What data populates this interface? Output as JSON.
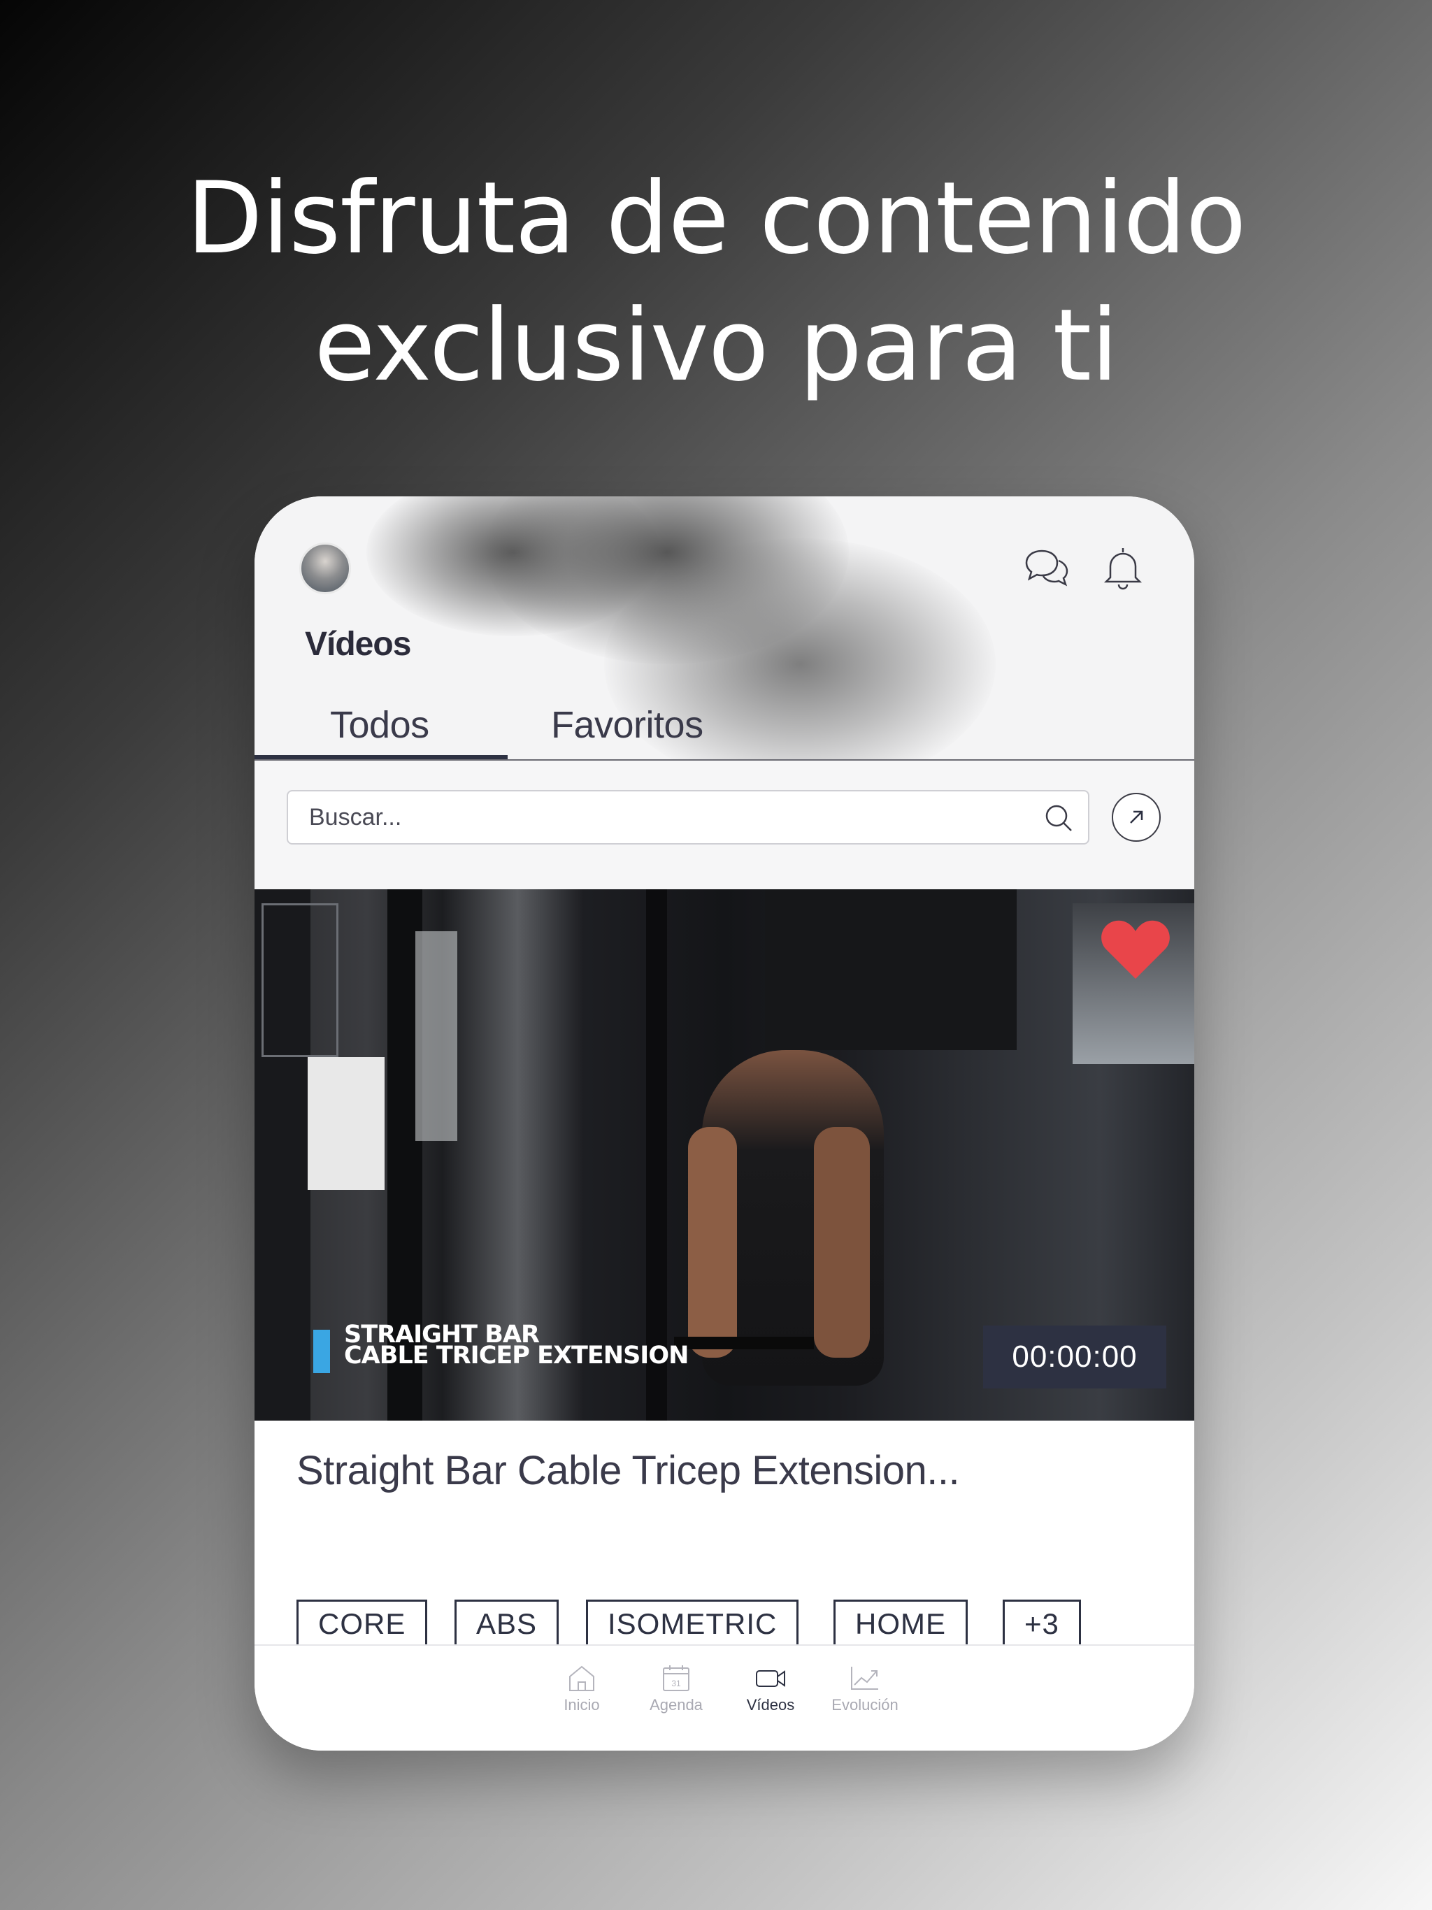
{
  "headline": {
    "line1": "Disfruta de contenido",
    "line2": "exclusivo para ti"
  },
  "app": {
    "section_title": "Vídeos",
    "tabs": [
      {
        "label": "Todos",
        "active": true
      },
      {
        "label": "Favoritos",
        "active": false
      }
    ],
    "search": {
      "placeholder": "Buscar..."
    },
    "video": {
      "caption_line1": "STRAIGHT BAR",
      "caption_line2": "CABLE TRICEP EXTENSION",
      "duration": "00:00:00",
      "favorite": true,
      "title": "Straight Bar Cable Tricep Extension...",
      "tags": [
        "CORE",
        "ABS",
        "ISOMETRIC",
        "HOME",
        "+3"
      ]
    },
    "nav": [
      {
        "label": "Inicio",
        "icon": "home-icon"
      },
      {
        "label": "Agenda",
        "icon": "calendar-icon",
        "icon_text": "31"
      },
      {
        "label": "Vídeos",
        "icon": "video-camera-icon",
        "active": true
      },
      {
        "label": "Evolución",
        "icon": "trend-chart-icon"
      }
    ]
  },
  "colors": {
    "accent": "#2d3142",
    "heart": "#e9454a",
    "caption_bar": "#3aa6e3"
  }
}
